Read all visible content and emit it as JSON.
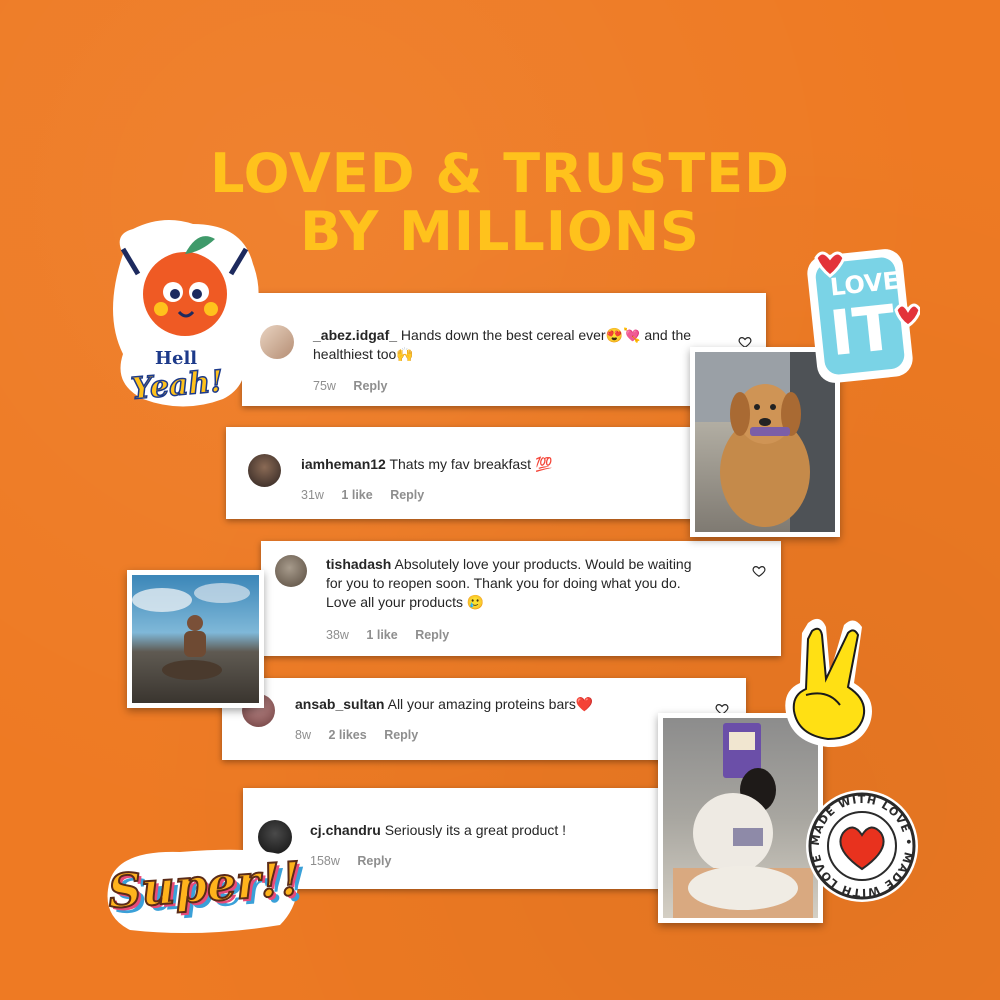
{
  "headline": {
    "line1": "LOVED & TRUSTED",
    "line2": "BY MILLIONS"
  },
  "colors": {
    "background": "#ee7a23",
    "headline": "#ffc21c",
    "meta": "#8e8e8e"
  },
  "comments": [
    {
      "username": "_abez.idgaf_",
      "text": "Hands down the best cereal ever😍💘 and the",
      "text2": "healthiest too🙌",
      "time": "75w",
      "likes": "",
      "reply": "Reply"
    },
    {
      "username": "iamheman12",
      "text": "Thats my fav breakfast 💯",
      "time": "31w",
      "likes": "1 like",
      "reply": "Reply"
    },
    {
      "username": "tishadash",
      "text": "Absolutely love your products. Would be waiting",
      "text2": "for you to reopen soon. Thank you for doing what you do.",
      "text3": "Love all your products 🥲",
      "time": "38w",
      "likes": "1 like",
      "reply": "Reply"
    },
    {
      "username": "ansab_sultan",
      "text": "All your amazing proteins bars❤️",
      "time": "8w",
      "likes": "2 likes",
      "reply": "Reply"
    },
    {
      "username": "cj.chandru",
      "text": "Seriously its a great product !",
      "time": "158w",
      "likes": "",
      "reply": "Reply"
    }
  ],
  "stickers": {
    "hell_yeah": {
      "line1": "Hell",
      "line2": "Yeah!"
    },
    "love_it": {
      "line1": "LOVE",
      "line2": "IT"
    },
    "super": "Super!!",
    "stamp": {
      "ring": "MADE WITH LOVE • MADE WITH LOVE •"
    }
  },
  "icons": [
    "heart-outline-icon",
    "peace-hand-icon",
    "heart-stamp-icon"
  ]
}
